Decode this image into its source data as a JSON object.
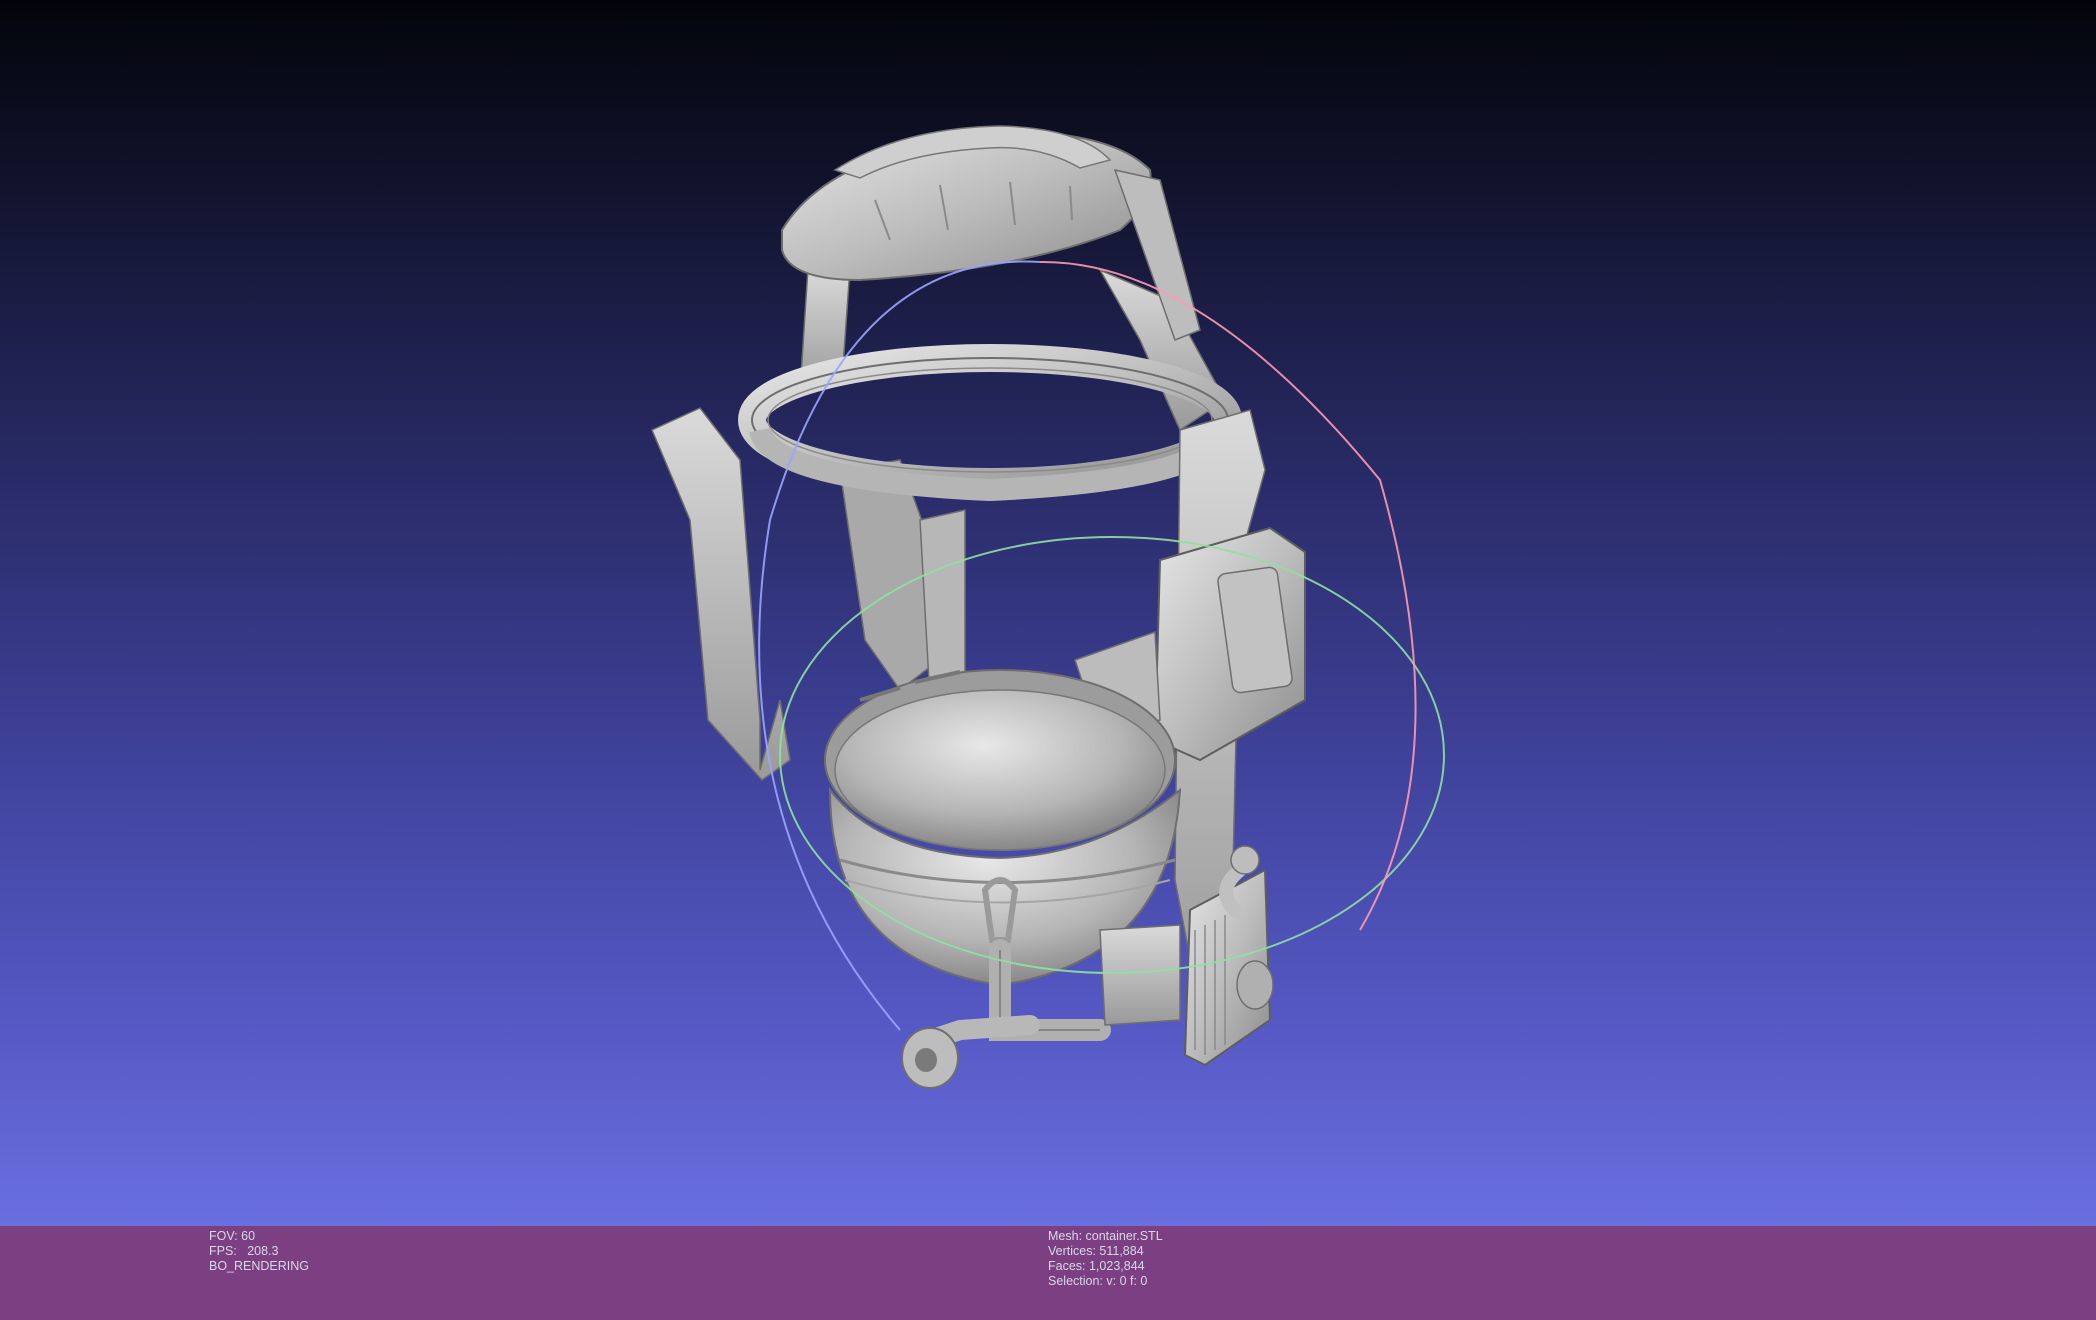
{
  "viewport": {
    "background_top": "#03040a",
    "background_bottom": "#6a6fe0",
    "model_color": "#c8c8c8",
    "trackball": {
      "horizontal_ring": "#8fe0a0",
      "vertical_ring_left": "#9aa4ff",
      "vertical_ring_right": "#ff9ab0"
    }
  },
  "status_bar": {
    "background": "#7b3f82",
    "left": {
      "fov": "FOV: 60",
      "fps": "FPS:   208.3",
      "mode": "BO_RENDERING"
    },
    "right": {
      "mesh": "Mesh: container.STL",
      "vertices": "Vertices: 511,884",
      "faces": "Faces: 1,023,844",
      "selection": "Selection: v: 0 f: 0"
    }
  }
}
